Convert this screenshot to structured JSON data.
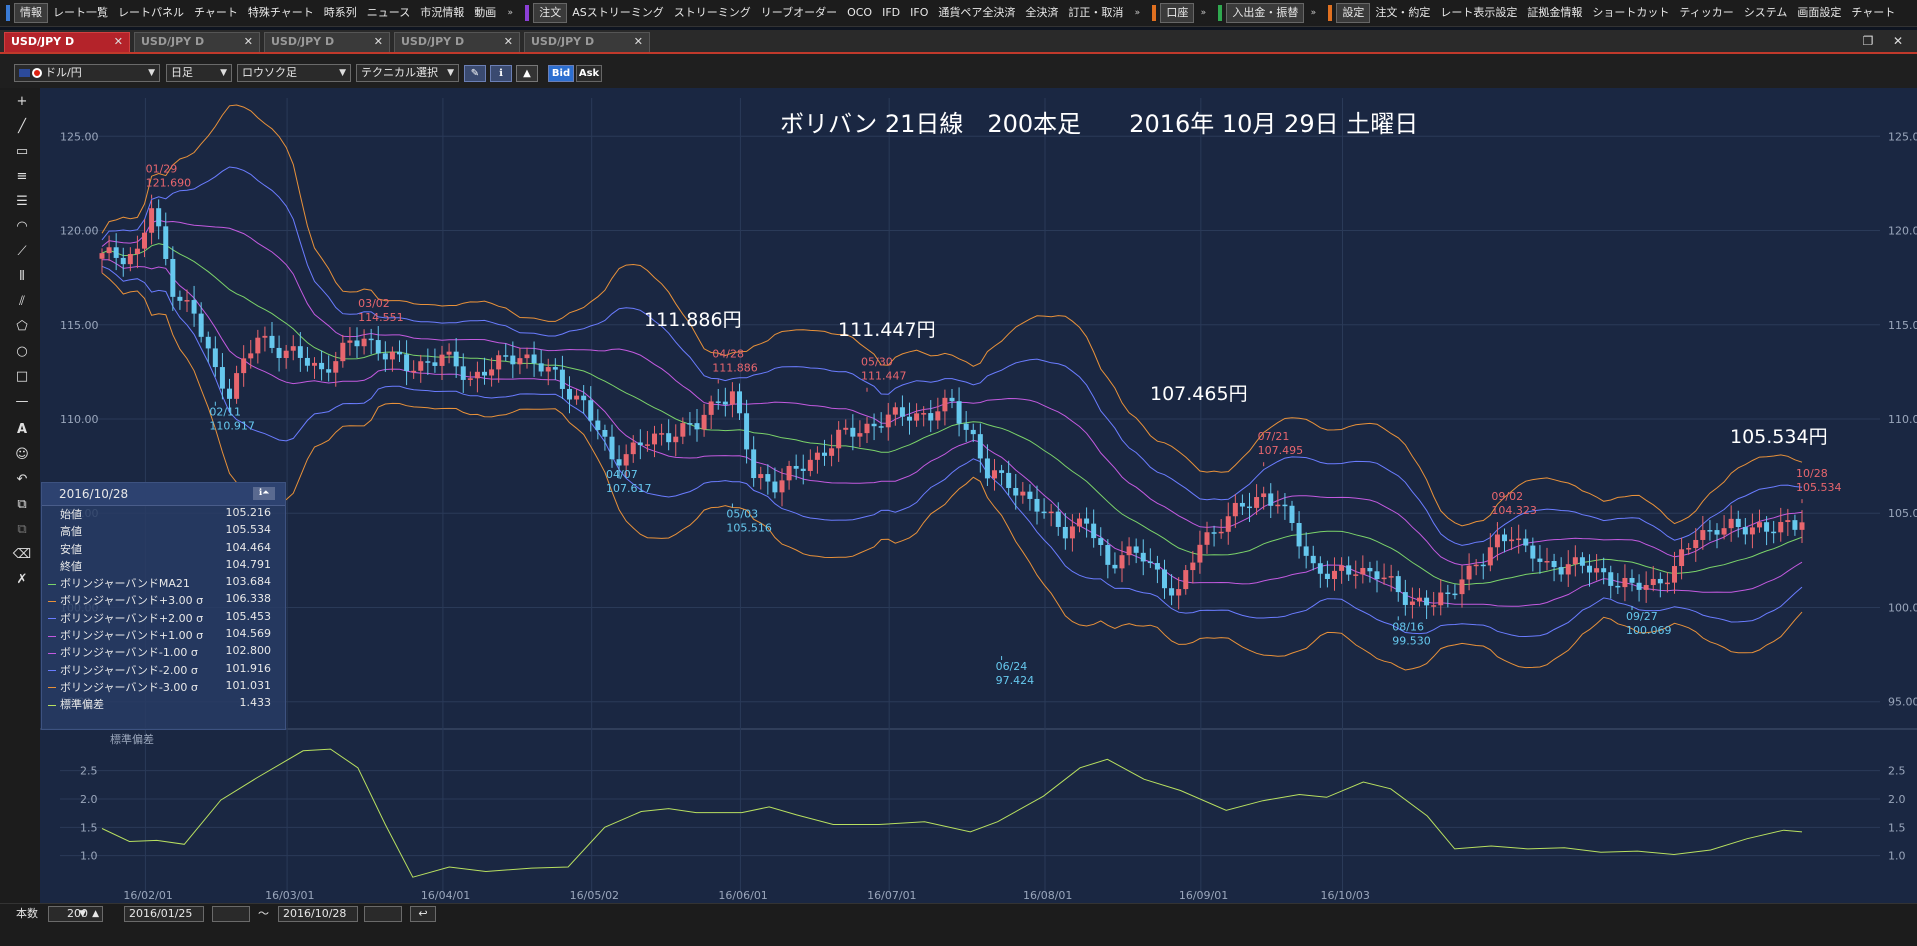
{
  "menubar": {
    "groups": [
      {
        "color": "#3a7bd5",
        "items": [
          "情報",
          "レート一覧",
          "レートパネル",
          "チャート",
          "特殊チャート",
          "時系列",
          "ニュース",
          "市況情報",
          "動画"
        ],
        "selected": 0
      },
      {
        "color": "#8b3fd6",
        "items": [
          "注文",
          "ASストリーミング",
          "ストリーミング",
          "リーブオーダー",
          "OCO",
          "IFD",
          "IFO",
          "通貨ペア全決済",
          "全決済",
          "訂正・取消"
        ],
        "selected": 0
      },
      {
        "color": "#e07020",
        "items": [
          "口座"
        ],
        "selected": 0
      },
      {
        "color": "#2fa84f",
        "items": [
          "入出金・振替"
        ],
        "selected": 0
      },
      {
        "color": "#e07020",
        "items": [
          "設定",
          "注文・約定",
          "レート表示設定",
          "証拠金情報",
          "ショートカット",
          "ティッカー",
          "システム",
          "画面設定",
          "チャート"
        ],
        "selected": 0
      }
    ]
  },
  "tabs": [
    {
      "label": "USD/JPY D",
      "active": true
    },
    {
      "label": "USD/JPY D",
      "active": false
    },
    {
      "label": "USD/JPY D",
      "active": false
    },
    {
      "label": "USD/JPY D",
      "active": false
    },
    {
      "label": "USD/JPY D",
      "active": false
    }
  ],
  "toolbar": {
    "pair": "ドル/円",
    "period": "日足",
    "chart_style": "ロウソク足",
    "technical": "テクニカル選択",
    "bid": "Bid",
    "ask": "Ask"
  },
  "chart_title": "ボリバン 21日線　200本足　　2016年 10月 29日 土曜日",
  "annotations": [
    {
      "text": "111.886円",
      "date": "16/04/28",
      "value": 111.886
    },
    {
      "text": "111.447円",
      "date": "16/05/30",
      "value": 111.447
    },
    {
      "text": "107.465円",
      "date": "16/07/21",
      "value": 107.495
    },
    {
      "text": "105.534円",
      "date": "16/10/28",
      "value": 105.534
    }
  ],
  "info_panel": {
    "date": "2016/10/28",
    "rows": [
      {
        "label": "始値",
        "value": "105.216",
        "color": ""
      },
      {
        "label": "高値",
        "value": "105.534",
        "color": ""
      },
      {
        "label": "安値",
        "value": "104.464",
        "color": ""
      },
      {
        "label": "終値",
        "value": "104.791",
        "color": ""
      },
      {
        "label": "ボリンジャーバンドMA21",
        "value": "103.684",
        "color": "#7bd36a"
      },
      {
        "label": "ボリンジャーバンド+3.00 σ",
        "value": "106.338",
        "color": "#e8913a"
      },
      {
        "label": "ボリンジャーバンド+2.00 σ",
        "value": "105.453",
        "color": "#6a7cff"
      },
      {
        "label": "ボリンジャーバンド+1.00 σ",
        "value": "104.569",
        "color": "#c35ae0"
      },
      {
        "label": "ボリンジャーバンド-1.00 σ",
        "value": "102.800",
        "color": "#c35ae0"
      },
      {
        "label": "ボリンジャーバンド-2.00 σ",
        "value": "101.916",
        "color": "#6a7cff"
      },
      {
        "label": "ボリンジャーバンド-3.00 σ",
        "value": "101.031",
        "color": "#e8913a"
      },
      {
        "label": "標準偏差",
        "value": "1.433",
        "color": "#b8e060"
      }
    ]
  },
  "sub_chart_label": "標準偏差",
  "bottom": {
    "count_label": "本数",
    "count": "200",
    "start_date": "2016/01/25",
    "tilde": "〜",
    "end_date": "2016/10/28"
  },
  "chart_data": {
    "type": "candlestick",
    "title": "ボリバン 21日線　200本足　　2016年 10月 29日 土曜日",
    "y_ticks": [
      "125.00",
      "120.00",
      "115.00",
      "110.00",
      "105.00",
      "100.00",
      "95.00"
    ],
    "ylim": [
      93.5,
      126.5
    ],
    "x_ticks": [
      "16/02/01",
      "16/03/01",
      "16/04/01",
      "16/05/02",
      "16/06/01",
      "16/07/01",
      "16/08/01",
      "16/09/01",
      "16/10/03"
    ],
    "close_anchor": [
      [
        0,
        118.6
      ],
      [
        5,
        118.8
      ],
      [
        7,
        121.2
      ],
      [
        10,
        117.0
      ],
      [
        13,
        115.5
      ],
      [
        16,
        112.5
      ],
      [
        18,
        111.5
      ],
      [
        22,
        114.3
      ],
      [
        27,
        113.4
      ],
      [
        31,
        112.6
      ],
      [
        35,
        113.9
      ],
      [
        37,
        114.3
      ],
      [
        43,
        112.7
      ],
      [
        48,
        113.3
      ],
      [
        52,
        112.2
      ],
      [
        56,
        112.9
      ],
      [
        59,
        113.5
      ],
      [
        64,
        112.2
      ],
      [
        68,
        110.8
      ],
      [
        72,
        107.9
      ],
      [
        76,
        108.6
      ],
      [
        81,
        109.4
      ],
      [
        84,
        109.6
      ],
      [
        87,
        111.2
      ],
      [
        89,
        111.3
      ],
      [
        92,
        107.0
      ],
      [
        95,
        106.6
      ],
      [
        98,
        107.2
      ],
      [
        104,
        109.0
      ],
      [
        110,
        109.9
      ],
      [
        114,
        110.3
      ],
      [
        117,
        110.2
      ],
      [
        120,
        110.8
      ],
      [
        123,
        109.0
      ],
      [
        125,
        107.0
      ],
      [
        128,
        106.7
      ],
      [
        133,
        104.9
      ],
      [
        136,
        104.2
      ],
      [
        139,
        104.5
      ],
      [
        142,
        102.2
      ],
      [
        144,
        103.0
      ],
      [
        147,
        102.6
      ],
      [
        150,
        101.4
      ],
      [
        152,
        100.7
      ],
      [
        155,
        103.4
      ],
      [
        158,
        104.5
      ],
      [
        161,
        105.3
      ],
      [
        164,
        106.0
      ],
      [
        166,
        105.6
      ],
      [
        168,
        104.2
      ],
      [
        171,
        102.2
      ],
      [
        174,
        101.6
      ],
      [
        177,
        102.1
      ],
      [
        180,
        101.8
      ],
      [
        183,
        100.8
      ],
      [
        185,
        100.4
      ],
      [
        188,
        100.2
      ],
      [
        190,
        100.5
      ],
      [
        192,
        101.8
      ],
      [
        195,
        102.4
      ],
      [
        197,
        103.5
      ],
      [
        199,
        104.1
      ],
      [
        201,
        103.0
      ],
      [
        204,
        102.1
      ],
      [
        207,
        102.4
      ],
      [
        210,
        102.0
      ],
      [
        213,
        101.6
      ],
      [
        216,
        101.0
      ],
      [
        219,
        101.3
      ],
      [
        222,
        102.0
      ],
      [
        225,
        103.8
      ],
      [
        228,
        104.3
      ],
      [
        231,
        104.1
      ],
      [
        234,
        104.4
      ],
      [
        237,
        104.1
      ],
      [
        239,
        104.4
      ],
      [
        240,
        104.8
      ]
    ],
    "mark_labels": [
      {
        "date": "01/29",
        "value": 121.69,
        "type": "high"
      },
      {
        "date": "02/11",
        "value": 110.917,
        "type": "low"
      },
      {
        "date": "03/02",
        "value": 114.551,
        "type": "high"
      },
      {
        "date": "04/07",
        "value": 107.617,
        "type": "low"
      },
      {
        "date": "04/28",
        "value": 111.886,
        "type": "high"
      },
      {
        "date": "05/03",
        "value": 105.516,
        "type": "low"
      },
      {
        "date": "05/30",
        "value": 111.447,
        "type": "high"
      },
      {
        "date": "06/24",
        "value": 97.424,
        "type": "low"
      },
      {
        "date": "07/21",
        "value": 107.495,
        "type": "high"
      },
      {
        "date": "08/16",
        "value": 99.53,
        "type": "low"
      },
      {
        "date": "09/02",
        "value": 104.323,
        "type": "high"
      },
      {
        "date": "09/27",
        "value": 100.069,
        "type": "low"
      },
      {
        "date": "10/28",
        "value": 105.534,
        "type": "high"
      }
    ],
    "bands": {
      "ma": "#7bd36a",
      "s1": "#c35ae0",
      "s2": "#6a7cff",
      "s3": "#e8913a"
    },
    "up_color": "#e8666e",
    "down_color": "#66c8ee",
    "stddev": {
      "y_ticks": [
        "2.5",
        "2.0",
        "1.5",
        "1.0"
      ],
      "ylim": [
        0.5,
        2.9
      ],
      "anchor": [
        [
          0,
          1.48
        ],
        [
          3,
          1.25
        ],
        [
          6,
          1.27
        ],
        [
          9,
          1.2
        ],
        [
          13,
          1.98
        ],
        [
          17,
          2.38
        ],
        [
          22,
          2.85
        ],
        [
          25,
          2.88
        ],
        [
          28,
          2.55
        ],
        [
          31,
          1.55
        ],
        [
          34,
          0.62
        ],
        [
          38,
          0.8
        ],
        [
          42,
          0.72
        ],
        [
          47,
          0.78
        ],
        [
          51,
          0.8
        ],
        [
          55,
          1.5
        ],
        [
          59,
          1.78
        ],
        [
          62,
          1.83
        ],
        [
          65,
          1.76
        ],
        [
          70,
          1.76
        ],
        [
          73,
          1.86
        ],
        [
          76,
          1.72
        ],
        [
          80,
          1.55
        ],
        [
          85,
          1.55
        ],
        [
          90,
          1.6
        ],
        [
          95,
          1.42
        ],
        [
          98,
          1.6
        ],
        [
          103,
          2.05
        ],
        [
          107,
          2.55
        ],
        [
          110,
          2.7
        ],
        [
          114,
          2.35
        ],
        [
          118,
          2.15
        ],
        [
          123,
          1.8
        ],
        [
          127,
          1.97
        ],
        [
          131,
          2.08
        ],
        [
          134,
          2.03
        ],
        [
          138,
          2.3
        ],
        [
          141,
          2.18
        ],
        [
          145,
          1.7
        ],
        [
          148,
          1.12
        ],
        [
          152,
          1.17
        ],
        [
          156,
          1.12
        ],
        [
          160,
          1.14
        ],
        [
          164,
          1.06
        ],
        [
          168,
          1.08
        ],
        [
          172,
          1.02
        ],
        [
          176,
          1.1
        ],
        [
          180,
          1.3
        ],
        [
          184,
          1.45
        ],
        [
          186,
          1.42
        ]
      ]
    }
  }
}
